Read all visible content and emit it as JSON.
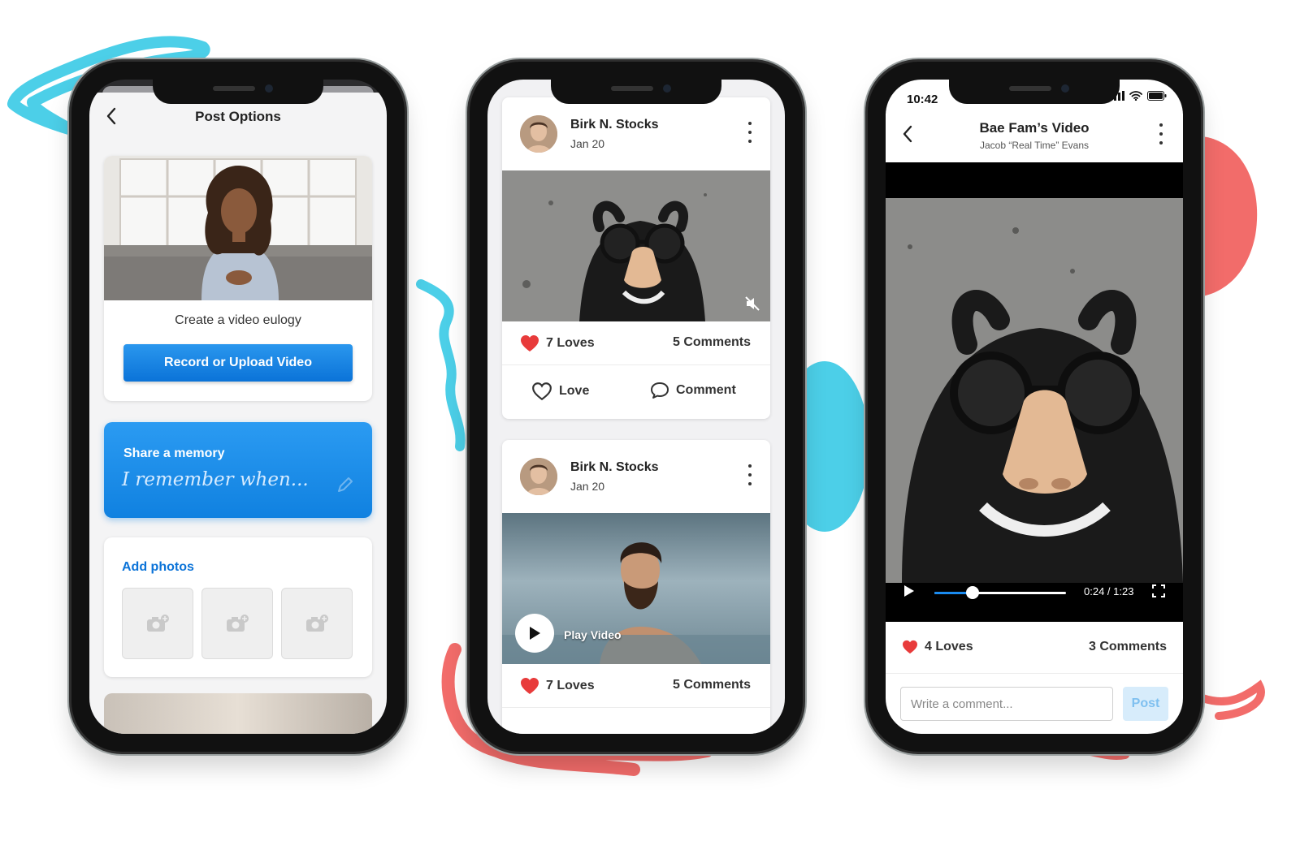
{
  "colors": {
    "accent": "#1081e0",
    "decor_cyan": "#4ccfe8",
    "decor_coral": "#f26c6a",
    "heart": "#e83b3b"
  },
  "phone1": {
    "title": "Post Options",
    "eulogy": {
      "text": "Create a video eulogy",
      "button": "Record or Upload Video"
    },
    "memory": {
      "title": "Share a memory",
      "placeholder": "I remember when..."
    },
    "photos": {
      "title": "Add photos",
      "slot_icon": "add-camera-icon",
      "slots": 3
    }
  },
  "phone2": {
    "posts": [
      {
        "author": "Birk N. Stocks",
        "date": "Jan 20",
        "loves": "7 Loves",
        "comments": "5 Comments",
        "love_action": "Love",
        "comment_action": "Comment",
        "media_icon": "mute-icon"
      },
      {
        "author": "Birk N. Stocks",
        "date": "Jan 20",
        "play_label": "Play Video",
        "loves": "7 Loves",
        "comments": "5 Comments"
      }
    ]
  },
  "phone3": {
    "status_time": "10:42",
    "title": "Bae Fam’s Video",
    "subtitle": "Jacob “Real Time” Evans",
    "player": {
      "time": "0:24 / 1:23",
      "progress": 0.29
    },
    "loves": "4 Loves",
    "comments": "3 Comments",
    "comment_placeholder": "Write a comment...",
    "post_button": "Post"
  }
}
